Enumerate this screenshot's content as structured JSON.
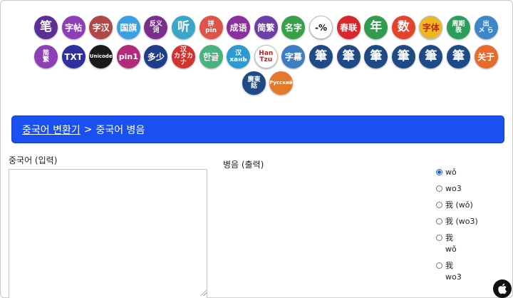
{
  "icons_row1": [
    {
      "id": "bi",
      "label": "笔",
      "bg": "#5b2f93",
      "fg": "#ffffff"
    },
    {
      "id": "zitie",
      "label": "字帖",
      "bg": "#8e3fb8",
      "fg": "#ffffff"
    },
    {
      "id": "zihan",
      "label": "字汉",
      "bg": "#b14848",
      "fg": "#ffffff"
    },
    {
      "id": "guoqi",
      "label": "国旗",
      "bg": "#3aa0df",
      "fg": "#ffffff"
    },
    {
      "id": "fanyi",
      "label": "反义\n词",
      "bg": "#7b2f8c",
      "fg": "#ffffff"
    },
    {
      "id": "ting",
      "label": "听",
      "bg": "#3aa6c9",
      "fg": "#ffffff"
    },
    {
      "id": "pinyin",
      "label": "拼\npin",
      "bg": "#e0524a",
      "fg": "#ffffff"
    },
    {
      "id": "chengyu",
      "label": "成语",
      "bg": "#8a2f9e",
      "fg": "#ffffff"
    },
    {
      "id": "jianfan",
      "label": "简繁",
      "bg": "#6b3fa6",
      "fg": "#ffffff"
    },
    {
      "id": "mingzi",
      "label": "名字",
      "bg": "#37a14a",
      "fg": "#ffffff"
    },
    {
      "id": "percent",
      "label": "-%",
      "bg": "#ffffff",
      "fg": "#111111"
    },
    {
      "id": "chunlian",
      "label": "春联",
      "bg": "#d8262a",
      "fg": "#ffffff"
    },
    {
      "id": "nian",
      "label": "年",
      "bg": "#2f9d4c",
      "fg": "#ffffff"
    },
    {
      "id": "shu",
      "label": "数",
      "bg": "#e4432c",
      "fg": "#ffffff"
    },
    {
      "id": "ziti",
      "label": "字体",
      "bg": "#f0b81f",
      "fg": "#c01f1f"
    },
    {
      "id": "zhouqi",
      "label": "周期\n表",
      "bg": "#2d9e5a",
      "fg": "#ffffff"
    },
    {
      "id": "chu",
      "label": "出\nメ ら",
      "bg": "#3c86c9",
      "fg": "#ffffff"
    }
  ],
  "icons_row2": [
    {
      "id": "jianfan2",
      "label": "简\n繁",
      "bg": "#8e3fb8",
      "fg": "#ffffff"
    },
    {
      "id": "txt",
      "label": "TXT",
      "bg": "#2f2f9e",
      "fg": "#ffffff"
    },
    {
      "id": "unicode",
      "label": "Unicode",
      "bg": "#1a1a1a",
      "fg": "#ffffff"
    },
    {
      "id": "pin1",
      "label": "pin1",
      "bg": "#b22b7a",
      "fg": "#ffffff"
    },
    {
      "id": "duoshao",
      "label": "多少",
      "bg": "#1f3d8a",
      "fg": "#ffffff"
    },
    {
      "id": "kata",
      "label": "汉\nカタカナ",
      "bg": "#d4322e",
      "fg": "#ffffff"
    },
    {
      "id": "hangul",
      "label": "한글",
      "bg": "#4ab27f",
      "fg": "#ffffff"
    },
    {
      "id": "hanru",
      "label": "汉\nханЬ",
      "bg": "#2b9ad1",
      "fg": "#ffffff"
    },
    {
      "id": "hantzu",
      "label": "Han\nTzu",
      "bg": "#ffffff",
      "fg": "#c01f1f"
    },
    {
      "id": "zimu",
      "label": "字幕",
      "bg": "#3b7fc2",
      "fg": "#ffffff"
    },
    {
      "id": "bi1",
      "label": "筆",
      "bg": "#1f4a86",
      "fg": "#ffffff"
    },
    {
      "id": "bi2",
      "label": "筆",
      "bg": "#1f4a86",
      "fg": "#ffffff"
    },
    {
      "id": "bi3",
      "label": "筆",
      "bg": "#1f4a86",
      "fg": "#ffffff"
    },
    {
      "id": "bi4",
      "label": "筆",
      "bg": "#1f4a86",
      "fg": "#ffffff"
    },
    {
      "id": "bi5",
      "label": "筆",
      "bg": "#1f4a86",
      "fg": "#ffffff"
    },
    {
      "id": "bi6",
      "label": "筆",
      "bg": "#1f4a86",
      "fg": "#ffffff"
    },
    {
      "id": "guanyu",
      "label": "关于",
      "bg": "#e86b2e",
      "fg": "#ffffff"
    }
  ],
  "icons_row3": [
    {
      "id": "guanghua",
      "label": "廣東\n話",
      "bg": "#1f4a86",
      "fg": "#ffffff"
    },
    {
      "id": "russian",
      "label": "Русский",
      "bg": "#e6782c",
      "fg": "#ffffff"
    }
  ],
  "breadcrumb": {
    "link_label": "중국어 변환기",
    "separator": ">",
    "current": "중국어 병음",
    "bg_color": "#1a4ff0"
  },
  "input": {
    "label": "중국어 (입력)",
    "value": "",
    "placeholder": ""
  },
  "output": {
    "label": "병음 (출력)"
  },
  "options": [
    {
      "text": "wǒ",
      "checked": true
    },
    {
      "text": "wo3",
      "checked": false
    },
    {
      "text": "我 (wǒ)",
      "checked": false
    },
    {
      "text": "我 (wo3)",
      "checked": false
    },
    {
      "text": "我\nwǒ",
      "checked": false
    },
    {
      "text": "我\nwo3",
      "checked": false
    }
  ]
}
